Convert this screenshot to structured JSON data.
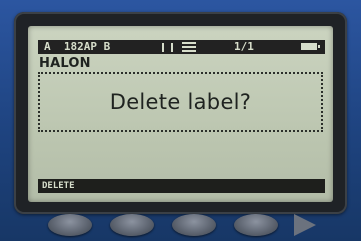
{
  "status": {
    "layout": "A  182AP B",
    "page": "1/1"
  },
  "label_name": "HALON",
  "prompt": "Delete label?",
  "softkey": "DELETE",
  "icons": [
    "text-align-icon",
    "line-spacing-icon",
    "battery-icon",
    "right-arrow-icon"
  ]
}
